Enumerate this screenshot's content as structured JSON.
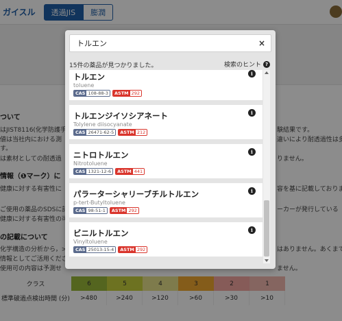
{
  "header": {
    "logo": "ガイスル",
    "tabs": [
      {
        "label": "透過JIS",
        "active": true
      },
      {
        "label": "膨潤",
        "active": false
      }
    ]
  },
  "background": {
    "lines": [
      "ついて",
      "はJIST8116(化学防護手",
      "値は当社内における測",
      "す。",
      "は素材としての耐透過",
      "情報（❶マーク）に",
      "健康に対する有害性に",
      "ご使用の薬品のSDSに記",
      "健康に対する有害性の可",
      "の記載について",
      "化学構造の分析から，>",
      "情報としてご活用くださ",
      "使用可の内容は予測せ"
    ],
    "right_fragments": [
      "験結果です。",
      "違いにより耐透過性は多",
      "りません。",
      "容を基に記載しておりま",
      "ーカーが発行している",
      "はありません。あくまで",
      "ません。"
    ],
    "class_label": "クラス",
    "time_label": "標準破過点検出時間 (分)",
    "classes": [
      "6",
      "5",
      "4",
      "3",
      "2",
      "1"
    ],
    "class_colors": [
      "#9ab83a",
      "#c6cf3c",
      "#e5e08a",
      "#f0a830",
      "#f4a6a0",
      "#f2b9b0"
    ],
    "times": [
      ">480",
      ">240",
      ">120",
      ">60",
      ">30",
      ">10"
    ]
  },
  "search": {
    "value": "トルエン",
    "clear_icon": "×",
    "result_count": "15件の薬品が見つかりました。",
    "hint": "検索のヒント",
    "hint_icon": "?"
  },
  "results": [
    {
      "name": "トルエン",
      "english": "toluene",
      "cas": "108-88-3",
      "astm": "292"
    },
    {
      "name": "トルエンジイソシアネート",
      "english": "Tolylene diisocyanate",
      "cas": "26471-62-5",
      "astm": "212"
    },
    {
      "name": "ニトロトルエン",
      "english": "Nitrotoluene",
      "cas": "1321-12-6",
      "astm": "441"
    },
    {
      "name": "パラーターシャリーブチルトルエン",
      "english": "p-tert-Butyltoluene",
      "cas": "98-51-1",
      "astm": "292"
    },
    {
      "name": "ビニルトルエン",
      "english": "Vinyltoluene",
      "cas": "25013-15-4",
      "astm": "292"
    }
  ],
  "badge_keys": {
    "cas": "CAS",
    "astm": "ASTM"
  },
  "info_icon": "i"
}
